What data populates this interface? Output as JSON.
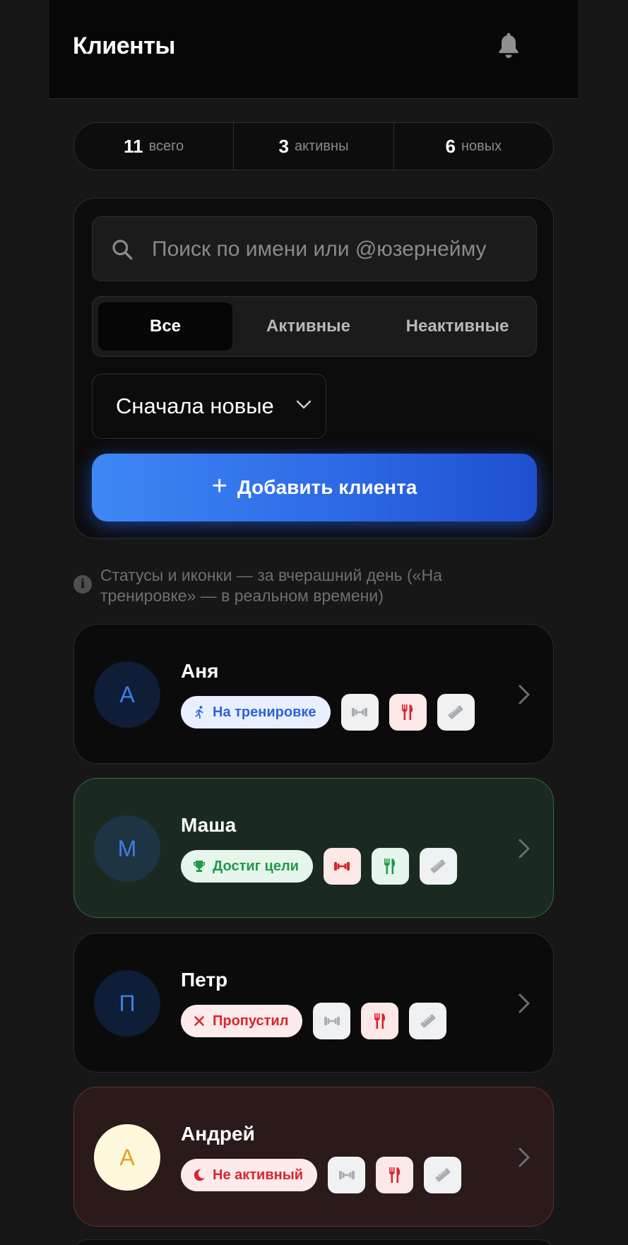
{
  "header": {
    "title": "Клиенты",
    "bell_icon": "bell-icon"
  },
  "stats": [
    {
      "num": "11",
      "label": "всего"
    },
    {
      "num": "3",
      "label": "активны"
    },
    {
      "num": "6",
      "label": "новых"
    }
  ],
  "search": {
    "placeholder": "Поиск по имени или @юзернейму",
    "value": ""
  },
  "filters": {
    "all": "Все",
    "active": "Активные",
    "inactive": "Неактивные",
    "selected": "Все"
  },
  "sort": {
    "label": "Сначала новые"
  },
  "add_button": {
    "plus": "+",
    "label": "Добавить клиента"
  },
  "hint": {
    "text": "Статусы и иконки — за вчерашний день («На тренировке» — в реальном времени)"
  },
  "colors": {
    "accent": "#2d6ae6",
    "goal_card_bg": "#1a2a21",
    "inactive_card_bg": "#2b1a1a",
    "icon_grey": "#a9aeb6",
    "icon_red": "#d7262e",
    "icon_green": "#1f9a47"
  },
  "clients": [
    {
      "initial": "А",
      "name": "Аня",
      "status": "На тренировке",
      "status_color": "blue",
      "status_icon": "running-icon",
      "workout": "grey",
      "food": "red",
      "measure": "grey"
    },
    {
      "initial": "М",
      "name": "Маша",
      "status": "Достиг цели",
      "status_color": "green",
      "status_icon": "trophy-icon",
      "workout": "red",
      "food": "green",
      "measure": "grey"
    },
    {
      "initial": "П",
      "name": "Петр",
      "status": "Пропустил",
      "status_color": "red",
      "status_icon": "cross-icon",
      "workout": "grey",
      "food": "red",
      "measure": "grey"
    },
    {
      "initial": "А",
      "name": "Андрей",
      "status": "Не активный",
      "status_color": "red",
      "status_icon": "moon-icon",
      "workout": "grey",
      "food": "red",
      "measure": "grey"
    }
  ]
}
